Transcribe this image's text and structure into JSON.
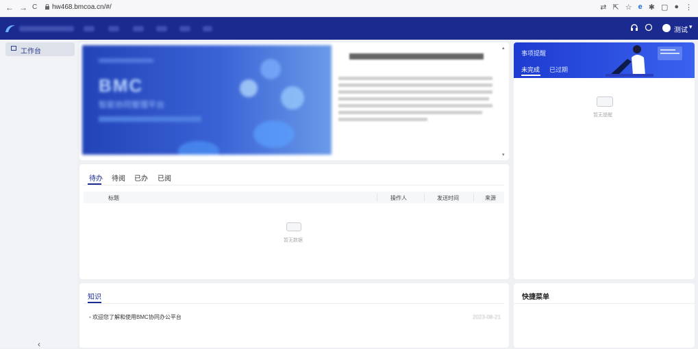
{
  "browser": {
    "url": "hw468.bmcoa.cn/#/",
    "nav_back": "←",
    "nav_forward": "→",
    "nav_reload": "C",
    "menu": "⋮"
  },
  "app": {
    "user_name": "测试",
    "user_caret": "▾"
  },
  "sidebar": {
    "items": [
      {
        "label": "工作台"
      }
    ],
    "collapse": "‹"
  },
  "banner": {
    "brand": "BMC",
    "tagline": "智能协同管理平台"
  },
  "todo": {
    "tabs": [
      {
        "label": "待办"
      },
      {
        "label": "待阅"
      },
      {
        "label": "已办"
      },
      {
        "label": "已阅"
      }
    ],
    "columns": [
      "标题",
      "操作人",
      "发送时间",
      "来源"
    ],
    "empty_text": "暂无数据"
  },
  "tasks": {
    "title": "事项提醒",
    "tabs": [
      {
        "label": "未完成"
      },
      {
        "label": "已过期"
      }
    ],
    "empty_text": "暂无提醒"
  },
  "knowledge": {
    "title": "知识",
    "items": [
      {
        "text": "欢迎您了解和使用BMC协同办公平台",
        "date": "2023-08-21"
      }
    ]
  },
  "quick_entry": {
    "title": "快捷菜单"
  }
}
